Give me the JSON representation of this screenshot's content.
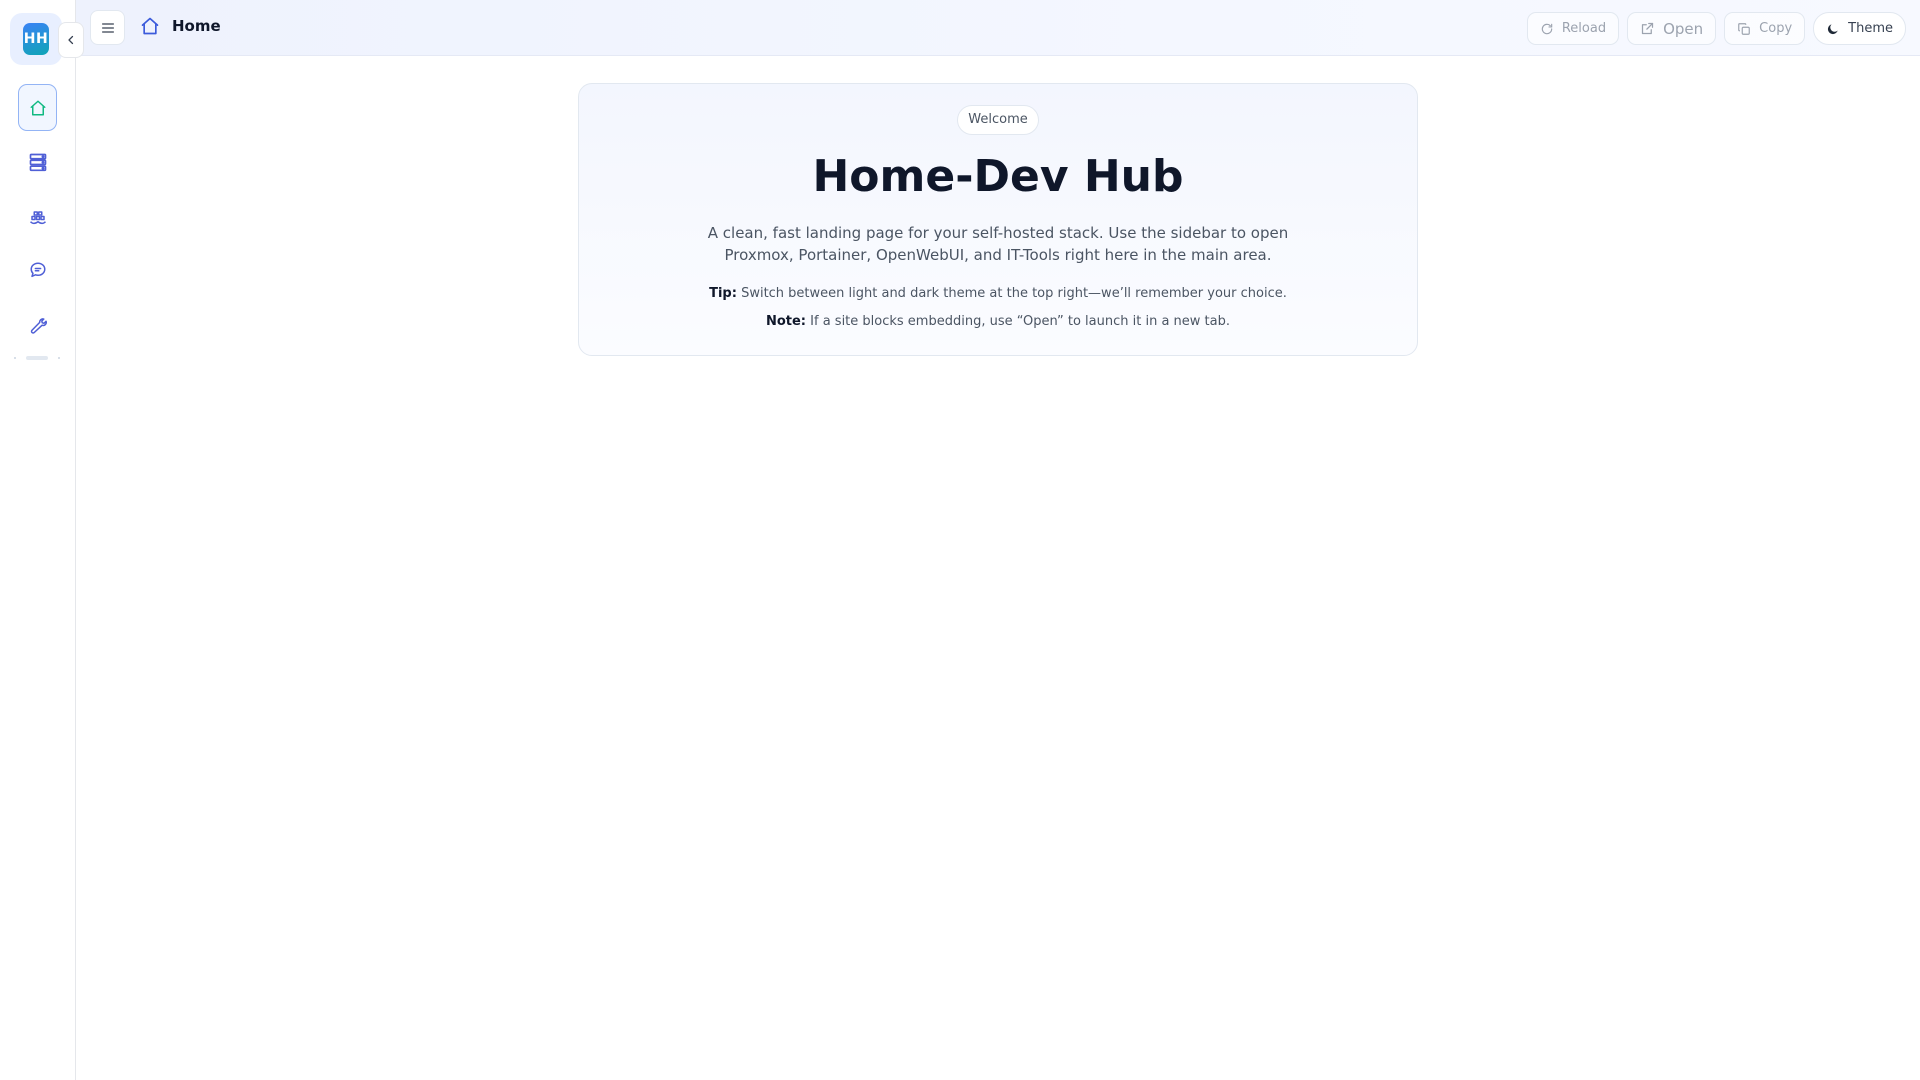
{
  "app": {
    "logo_text": "HH"
  },
  "sidebar": {
    "items": [
      {
        "name": "home",
        "icon": "home-icon",
        "active": true
      },
      {
        "name": "proxmox",
        "icon": "server-stack-icon",
        "active": false
      },
      {
        "name": "portainer",
        "icon": "container-ship-icon",
        "active": false
      },
      {
        "name": "openwebui",
        "icon": "chat-bubble-icon",
        "active": false
      },
      {
        "name": "it-tools",
        "icon": "wrench-icon",
        "active": false
      }
    ]
  },
  "header": {
    "title": "Home",
    "actions": {
      "reload": "Reload",
      "open": "Open",
      "copy": "Copy",
      "theme": "Theme"
    }
  },
  "welcome": {
    "badge": "Welcome",
    "title": "Home-Dev Hub",
    "description": "A clean, fast landing page for your self-hosted stack. Use the sidebar to open Proxmox, Portainer, OpenWebUI, and IT-Tools right here in the main area.",
    "tip_label": "Tip:",
    "tip_text": " Switch between light and dark theme at the top right—we’ll remember your choice.",
    "note_label": "Note:",
    "note_text": " If a site blocks embedding, use “Open” to launch it in a new tab."
  },
  "colors": {
    "accent": "#3b82f6",
    "active_icon": "#10b981",
    "nav_icon": "#4f5fd6"
  }
}
